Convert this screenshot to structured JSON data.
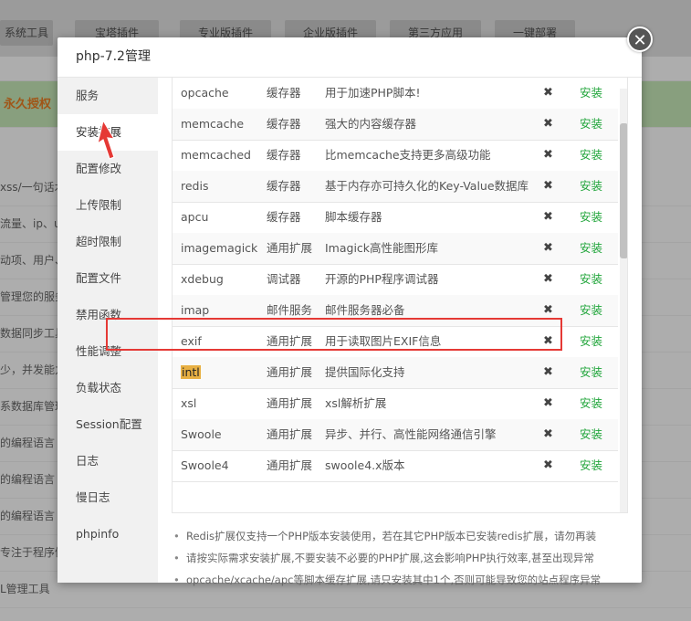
{
  "background": {
    "tabs": [
      "系统工具",
      "宝塔插件",
      "专业版插件",
      "企业版插件",
      "第三方应用",
      "一键部署"
    ],
    "banner": "永久授权",
    "list_items": [
      "xss/一句话木",
      "流量、ip、u",
      "动项、用户、",
      "管理您的服务",
      "数据同步工具",
      "少，并发能力",
      "系数据库管理",
      "的编程语言",
      "的编程语言",
      "的编程语言",
      "专注于程序健",
      "L管理工具"
    ]
  },
  "modal": {
    "title": "php-7.2管理",
    "close_icon": "close-icon"
  },
  "sidebar": {
    "items": [
      {
        "label": "服务"
      },
      {
        "label": "安装扩展",
        "active": true
      },
      {
        "label": "配置修改"
      },
      {
        "label": "上传限制"
      },
      {
        "label": "超时限制"
      },
      {
        "label": "配置文件"
      },
      {
        "label": "禁用函数"
      },
      {
        "label": "性能调整"
      },
      {
        "label": "负载状态"
      },
      {
        "label": "Session配置"
      },
      {
        "label": "日志"
      },
      {
        "label": "慢日志"
      },
      {
        "label": "phpinfo"
      }
    ]
  },
  "extensions": {
    "delete_icon": "✖",
    "install_label": "安装",
    "install_color": "#20a53a",
    "rows": [
      {
        "name": "opcache",
        "type": "缓存器",
        "desc": "用于加速PHP脚本!"
      },
      {
        "name": "memcache",
        "type": "缓存器",
        "desc": "强大的内容缓存器"
      },
      {
        "name": "memcached",
        "type": "缓存器",
        "desc": "比memcache支持更多高级功能"
      },
      {
        "name": "redis",
        "type": "缓存器",
        "desc": "基于内存亦可持久化的Key-Value数据库"
      },
      {
        "name": "apcu",
        "type": "缓存器",
        "desc": "脚本缓存器"
      },
      {
        "name": "imagemagick",
        "type": "通用扩展",
        "desc": "Imagick高性能图形库"
      },
      {
        "name": "xdebug",
        "type": "调试器",
        "desc": "开源的PHP程序调试器"
      },
      {
        "name": "imap",
        "type": "邮件服务",
        "desc": "邮件服务器必备"
      },
      {
        "name": "exif",
        "type": "通用扩展",
        "desc": "用于读取图片EXIF信息"
      },
      {
        "name": "intl",
        "type": "通用扩展",
        "desc": "提供国际化支持",
        "highlighted": true
      },
      {
        "name": "xsl",
        "type": "通用扩展",
        "desc": "xsl解析扩展"
      },
      {
        "name": "Swoole",
        "type": "通用扩展",
        "desc": "异步、并行、高性能网络通信引擎"
      },
      {
        "name": "Swoole4",
        "type": "通用扩展",
        "desc": "swoole4.x版本"
      }
    ]
  },
  "notes": [
    "Redis扩展仅支持一个PHP版本安装使用，若在其它PHP版本已安装redis扩展，请勿再装",
    "请按实际需求安装扩展,不要安装不必要的PHP扩展,这会影响PHP执行效率,甚至出现异常",
    "opcache/xcache/apc等脚本缓存扩展,请只安装其中1个,否则可能导致您的站点程序异常"
  ],
  "annotation_color": "#e53935"
}
